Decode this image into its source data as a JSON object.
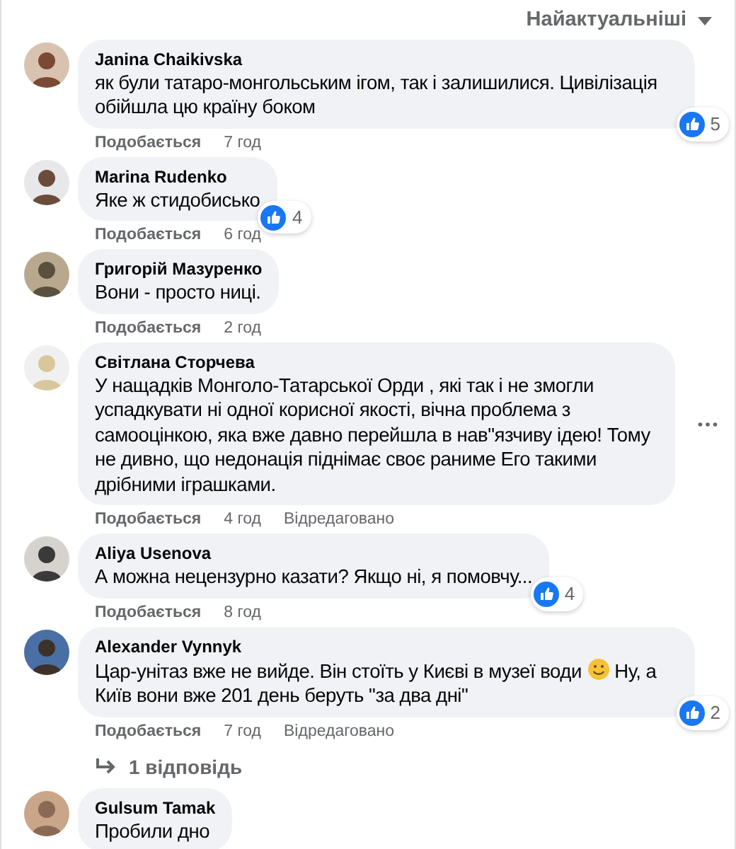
{
  "sort": {
    "label": "Найактуальніші"
  },
  "comments": [
    {
      "author": "Janina Chaikivska",
      "body": [
        {
          "kind": "text",
          "text": "як були татаро-монгольським ігом, так і залишилися. Цивілізація обійшла цю країну боком"
        }
      ],
      "reactions": "5",
      "like": "Подобається",
      "time": "7 год",
      "more_menu": false
    },
    {
      "author": "Marina Rudenko",
      "body": [
        {
          "kind": "text",
          "text": "Яке ж стидобисько"
        }
      ],
      "reactions": "4",
      "like": "Подобається",
      "time": "6 год",
      "more_menu": false
    },
    {
      "author": "Григорій Мазуренко",
      "body": [
        {
          "kind": "text",
          "text": "Вони - просто ниці."
        }
      ],
      "like": "Подобається",
      "time": "2 год",
      "more_menu": false
    },
    {
      "author": "Світлана Сторчева",
      "body": [
        {
          "kind": "text",
          "text": "У нащадків Монголо-Татарської Орди , які так і не змогли успадкувати ні одної корисної якості, вічна проблема з самооцінкою, яка вже давно перейшла в нав\"язчиву ідею! Тому не дивно, що недонація піднімає своє раниме Его такими дрібними іграшками."
        }
      ],
      "like": "Подобається",
      "time": "4 год",
      "edited": "Відредаговано",
      "more_menu": true
    },
    {
      "author": "Aliya Usenova",
      "body": [
        {
          "kind": "text",
          "text": "А можна нецензурно казати? Якщо ні, я помовчу..."
        }
      ],
      "reactions": "4",
      "like": "Подобається",
      "time": "8 год",
      "more_menu": false
    },
    {
      "author": "Alexander Vynnyk",
      "body": [
        {
          "kind": "text",
          "text": "Цар-унітаз вже не вийде. Він стоїть у Києві в музеї води "
        },
        {
          "kind": "emoji"
        },
        {
          "kind": "text",
          "text": " Ну, а Київ вони вже 201 день беруть \"за два дні\""
        }
      ],
      "reactions": "2",
      "like": "Подобається",
      "time": "7 год",
      "edited": "Відредаговано",
      "replies": "1 відповідь",
      "more_menu": false
    },
    {
      "author": "Gulsum Tamak",
      "body": [
        {
          "kind": "text",
          "text": "Пробили дно"
        }
      ],
      "more_menu": false
    }
  ]
}
